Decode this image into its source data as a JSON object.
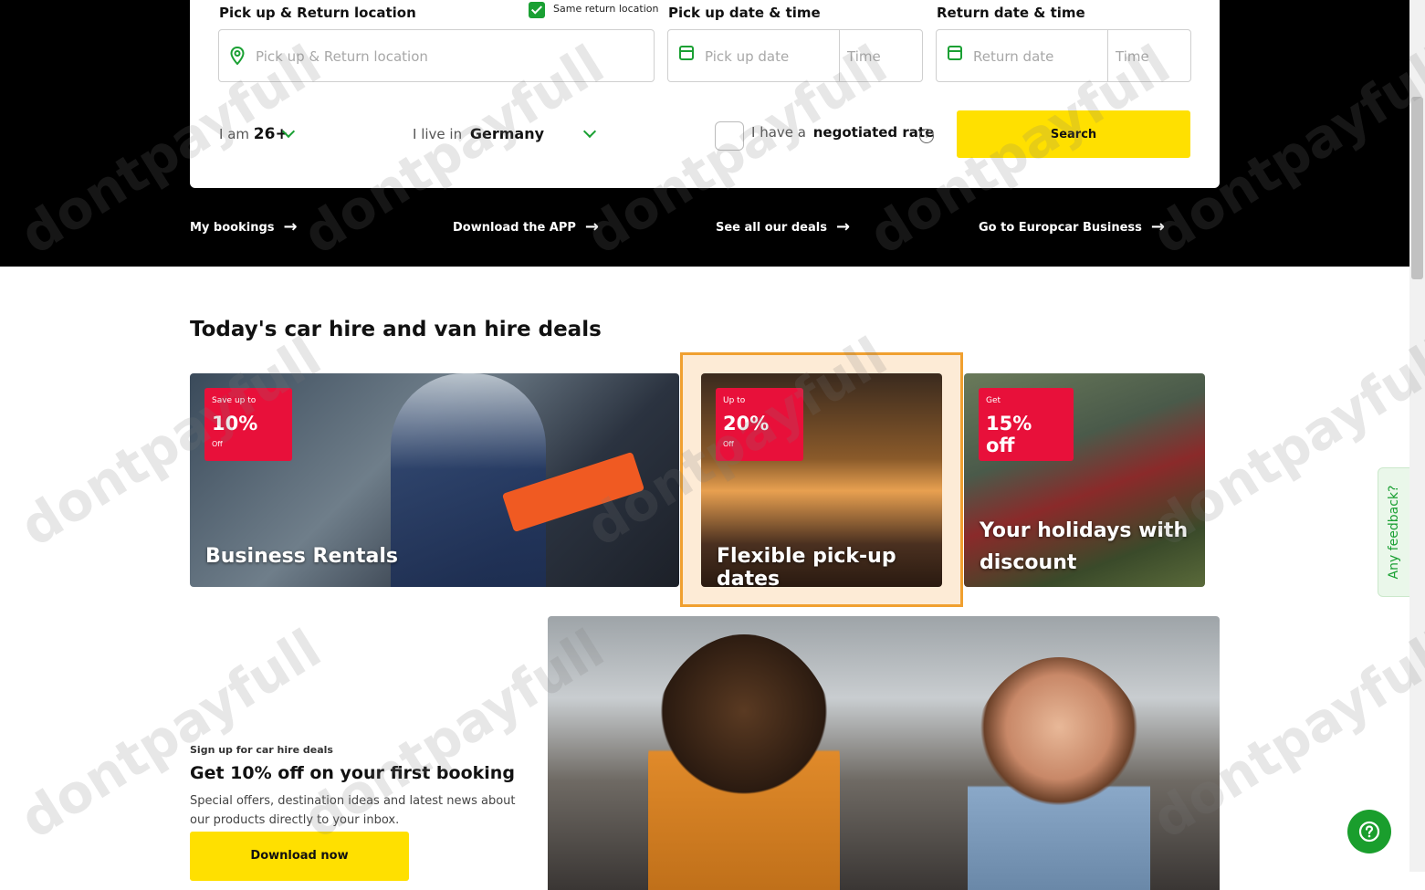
{
  "search": {
    "location_label": "Pick up & Return location",
    "same_return_label": "Same return location",
    "location_placeholder": "Pick up & Return location",
    "pickup_label": "Pick up date & time",
    "pickup_date_placeholder": "Pick up date",
    "pickup_time_placeholder": "Time",
    "return_label": "Return date & time",
    "return_date_placeholder": "Return date",
    "return_time_placeholder": "Time",
    "age_prefix": "I am",
    "age_value": "26+",
    "country_prefix": "I live in",
    "country_value": "Germany",
    "negotiated_prefix": "I have a",
    "negotiated_bold": "negotiated rate",
    "search_button": "Search",
    "same_return_checked": true
  },
  "quick_links": [
    "My bookings",
    "Download the APP",
    "See all our deals",
    "Go to Europcar Business"
  ],
  "deals": {
    "title": "Today's car hire and van hire deals",
    "cards": [
      {
        "pre": "Save up to",
        "big": "10%",
        "post": "Off",
        "title": "Business Rentals"
      },
      {
        "pre": "Up to",
        "big": "20%",
        "post": "Off",
        "title": "Flexible pick-up dates"
      },
      {
        "pre": "Get",
        "big": "15% off",
        "post": "",
        "title_line1": "Your holidays with",
        "title_line2": "discount"
      }
    ]
  },
  "signup": {
    "eyebrow": "Sign up for car hire deals",
    "title": "Get 10% off on your first booking",
    "description": "Special offers, destination ideas and latest news about our products directly to your inbox.",
    "button": "Download now"
  },
  "feedback_tab": "Any feedback?",
  "watermark": "dontpayfull",
  "colors": {
    "brand_green": "#1aa033",
    "brand_yellow": "#ffe000",
    "badge_red": "#e8103a",
    "highlight_orange": "#f0a030"
  }
}
